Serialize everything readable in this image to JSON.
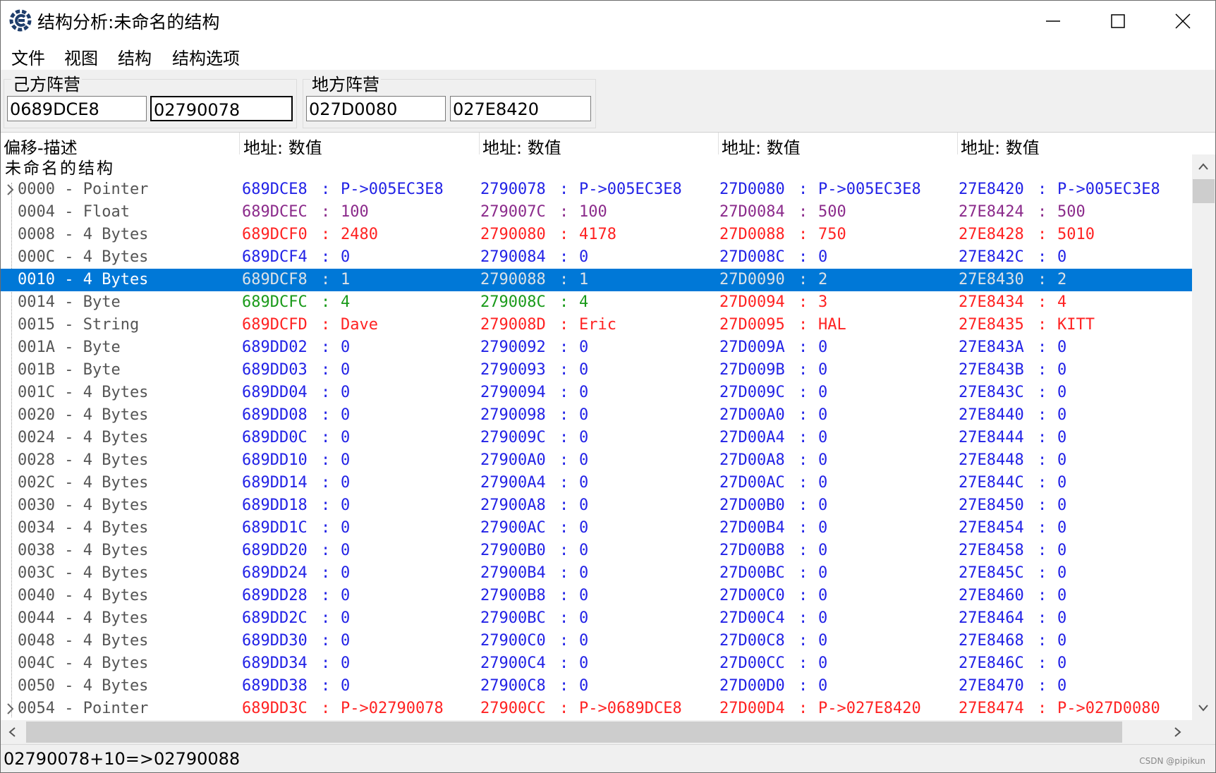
{
  "window": {
    "title": "结构分析:未命名的结构"
  },
  "menu": [
    "文件",
    "视图",
    "结构",
    "结构选项"
  ],
  "groups": [
    {
      "label": "己方阵营",
      "addresses": [
        "0689DCE8",
        "02790078"
      ]
    },
    {
      "label": "地方阵营",
      "addresses": [
        "027D0080",
        "027E8420"
      ]
    }
  ],
  "columns": [
    "偏移-描述",
    "地址: 数值",
    "地址: 数值",
    "地址: 数值",
    "地址: 数值"
  ],
  "struct_name": "未命名的结构",
  "colors": {
    "blue": "#2222e6",
    "red": "#ff2222",
    "purple": "#8b2b8b",
    "green": "#1a9a1a",
    "selection": "#0078d7"
  },
  "rows": [
    {
      "offset": "0000 - Pointer",
      "expandable": true,
      "cells": [
        {
          "addr": "689DCE8",
          "val": "P->005EC3E8",
          "color": "blue"
        },
        {
          "addr": "2790078",
          "val": "P->005EC3E8",
          "color": "blue"
        },
        {
          "addr": "27D0080",
          "val": "P->005EC3E8",
          "color": "blue"
        },
        {
          "addr": "27E8420",
          "val": "P->005EC3E8",
          "color": "blue"
        }
      ]
    },
    {
      "offset": "0004 - Float",
      "cells": [
        {
          "addr": "689DCEC",
          "val": "100",
          "color": "purple"
        },
        {
          "addr": "279007C",
          "val": "100",
          "color": "purple"
        },
        {
          "addr": "27D0084",
          "val": "500",
          "color": "purple"
        },
        {
          "addr": "27E8424",
          "val": "500",
          "color": "purple"
        }
      ]
    },
    {
      "offset": "0008 - 4 Bytes",
      "cells": [
        {
          "addr": "689DCF0",
          "val": "2480",
          "color": "red"
        },
        {
          "addr": "2790080",
          "val": "4178",
          "color": "red"
        },
        {
          "addr": "27D0088",
          "val": "750",
          "color": "red"
        },
        {
          "addr": "27E8428",
          "val": "5010",
          "color": "red"
        }
      ]
    },
    {
      "offset": "000C - 4 Bytes",
      "cells": [
        {
          "addr": "689DCF4",
          "val": "0",
          "color": "blue"
        },
        {
          "addr": "2790084",
          "val": "0",
          "color": "blue"
        },
        {
          "addr": "27D008C",
          "val": "0",
          "color": "blue"
        },
        {
          "addr": "27E842C",
          "val": "0",
          "color": "blue"
        }
      ]
    },
    {
      "offset": "0010 - 4 Bytes",
      "selected": true,
      "cells": [
        {
          "addr": "689DCF8",
          "val": "1",
          "color": "blue"
        },
        {
          "addr": "2790088",
          "val": "1",
          "color": "blue"
        },
        {
          "addr": "27D0090",
          "val": "2",
          "color": "red"
        },
        {
          "addr": "27E8430",
          "val": "2",
          "color": "red"
        }
      ]
    },
    {
      "offset": "0014 - Byte",
      "cells": [
        {
          "addr": "689DCFC",
          "val": "4",
          "color": "green"
        },
        {
          "addr": "279008C",
          "val": "4",
          "color": "green"
        },
        {
          "addr": "27D0094",
          "val": "3",
          "color": "red"
        },
        {
          "addr": "27E8434",
          "val": "4",
          "color": "red"
        }
      ]
    },
    {
      "offset": "0015 - String",
      "cells": [
        {
          "addr": "689DCFD",
          "val": "Dave",
          "color": "red"
        },
        {
          "addr": "279008D",
          "val": "Eric",
          "color": "red"
        },
        {
          "addr": "27D0095",
          "val": "HAL",
          "color": "red"
        },
        {
          "addr": "27E8435",
          "val": "KITT",
          "color": "red"
        }
      ]
    },
    {
      "offset": "001A - Byte",
      "cells": [
        {
          "addr": "689DD02",
          "val": "0",
          "color": "blue"
        },
        {
          "addr": "2790092",
          "val": "0",
          "color": "blue"
        },
        {
          "addr": "27D009A",
          "val": "0",
          "color": "blue"
        },
        {
          "addr": "27E843A",
          "val": "0",
          "color": "blue"
        }
      ]
    },
    {
      "offset": "001B - Byte",
      "cells": [
        {
          "addr": "689DD03",
          "val": "0",
          "color": "blue"
        },
        {
          "addr": "2790093",
          "val": "0",
          "color": "blue"
        },
        {
          "addr": "27D009B",
          "val": "0",
          "color": "blue"
        },
        {
          "addr": "27E843B",
          "val": "0",
          "color": "blue"
        }
      ]
    },
    {
      "offset": "001C - 4 Bytes",
      "cells": [
        {
          "addr": "689DD04",
          "val": "0",
          "color": "blue"
        },
        {
          "addr": "2790094",
          "val": "0",
          "color": "blue"
        },
        {
          "addr": "27D009C",
          "val": "0",
          "color": "blue"
        },
        {
          "addr": "27E843C",
          "val": "0",
          "color": "blue"
        }
      ]
    },
    {
      "offset": "0020 - 4 Bytes",
      "cells": [
        {
          "addr": "689DD08",
          "val": "0",
          "color": "blue"
        },
        {
          "addr": "2790098",
          "val": "0",
          "color": "blue"
        },
        {
          "addr": "27D00A0",
          "val": "0",
          "color": "blue"
        },
        {
          "addr": "27E8440",
          "val": "0",
          "color": "blue"
        }
      ]
    },
    {
      "offset": "0024 - 4 Bytes",
      "cells": [
        {
          "addr": "689DD0C",
          "val": "0",
          "color": "blue"
        },
        {
          "addr": "279009C",
          "val": "0",
          "color": "blue"
        },
        {
          "addr": "27D00A4",
          "val": "0",
          "color": "blue"
        },
        {
          "addr": "27E8444",
          "val": "0",
          "color": "blue"
        }
      ]
    },
    {
      "offset": "0028 - 4 Bytes",
      "cells": [
        {
          "addr": "689DD10",
          "val": "0",
          "color": "blue"
        },
        {
          "addr": "27900A0",
          "val": "0",
          "color": "blue"
        },
        {
          "addr": "27D00A8",
          "val": "0",
          "color": "blue"
        },
        {
          "addr": "27E8448",
          "val": "0",
          "color": "blue"
        }
      ]
    },
    {
      "offset": "002C - 4 Bytes",
      "cells": [
        {
          "addr": "689DD14",
          "val": "0",
          "color": "blue"
        },
        {
          "addr": "27900A4",
          "val": "0",
          "color": "blue"
        },
        {
          "addr": "27D00AC",
          "val": "0",
          "color": "blue"
        },
        {
          "addr": "27E844C",
          "val": "0",
          "color": "blue"
        }
      ]
    },
    {
      "offset": "0030 - 4 Bytes",
      "cells": [
        {
          "addr": "689DD18",
          "val": "0",
          "color": "blue"
        },
        {
          "addr": "27900A8",
          "val": "0",
          "color": "blue"
        },
        {
          "addr": "27D00B0",
          "val": "0",
          "color": "blue"
        },
        {
          "addr": "27E8450",
          "val": "0",
          "color": "blue"
        }
      ]
    },
    {
      "offset": "0034 - 4 Bytes",
      "cells": [
        {
          "addr": "689DD1C",
          "val": "0",
          "color": "blue"
        },
        {
          "addr": "27900AC",
          "val": "0",
          "color": "blue"
        },
        {
          "addr": "27D00B4",
          "val": "0",
          "color": "blue"
        },
        {
          "addr": "27E8454",
          "val": "0",
          "color": "blue"
        }
      ]
    },
    {
      "offset": "0038 - 4 Bytes",
      "cells": [
        {
          "addr": "689DD20",
          "val": "0",
          "color": "blue"
        },
        {
          "addr": "27900B0",
          "val": "0",
          "color": "blue"
        },
        {
          "addr": "27D00B8",
          "val": "0",
          "color": "blue"
        },
        {
          "addr": "27E8458",
          "val": "0",
          "color": "blue"
        }
      ]
    },
    {
      "offset": "003C - 4 Bytes",
      "cells": [
        {
          "addr": "689DD24",
          "val": "0",
          "color": "blue"
        },
        {
          "addr": "27900B4",
          "val": "0",
          "color": "blue"
        },
        {
          "addr": "27D00BC",
          "val": "0",
          "color": "blue"
        },
        {
          "addr": "27E845C",
          "val": "0",
          "color": "blue"
        }
      ]
    },
    {
      "offset": "0040 - 4 Bytes",
      "cells": [
        {
          "addr": "689DD28",
          "val": "0",
          "color": "blue"
        },
        {
          "addr": "27900B8",
          "val": "0",
          "color": "blue"
        },
        {
          "addr": "27D00C0",
          "val": "0",
          "color": "blue"
        },
        {
          "addr": "27E8460",
          "val": "0",
          "color": "blue"
        }
      ]
    },
    {
      "offset": "0044 - 4 Bytes",
      "cells": [
        {
          "addr": "689DD2C",
          "val": "0",
          "color": "blue"
        },
        {
          "addr": "27900BC",
          "val": "0",
          "color": "blue"
        },
        {
          "addr": "27D00C4",
          "val": "0",
          "color": "blue"
        },
        {
          "addr": "27E8464",
          "val": "0",
          "color": "blue"
        }
      ]
    },
    {
      "offset": "0048 - 4 Bytes",
      "cells": [
        {
          "addr": "689DD30",
          "val": "0",
          "color": "blue"
        },
        {
          "addr": "27900C0",
          "val": "0",
          "color": "blue"
        },
        {
          "addr": "27D00C8",
          "val": "0",
          "color": "blue"
        },
        {
          "addr": "27E8468",
          "val": "0",
          "color": "blue"
        }
      ]
    },
    {
      "offset": "004C - 4 Bytes",
      "cells": [
        {
          "addr": "689DD34",
          "val": "0",
          "color": "blue"
        },
        {
          "addr": "27900C4",
          "val": "0",
          "color": "blue"
        },
        {
          "addr": "27D00CC",
          "val": "0",
          "color": "blue"
        },
        {
          "addr": "27E846C",
          "val": "0",
          "color": "blue"
        }
      ]
    },
    {
      "offset": "0050 - 4 Bytes",
      "cells": [
        {
          "addr": "689DD38",
          "val": "0",
          "color": "blue"
        },
        {
          "addr": "27900C8",
          "val": "0",
          "color": "blue"
        },
        {
          "addr": "27D00D0",
          "val": "0",
          "color": "blue"
        },
        {
          "addr": "27E8470",
          "val": "0",
          "color": "blue"
        }
      ]
    },
    {
      "offset": "0054 - Pointer",
      "expandable": true,
      "cells": [
        {
          "addr": "689DD3C",
          "val": "P->02790078",
          "color": "red"
        },
        {
          "addr": "27900CC",
          "val": "P->0689DCE8",
          "color": "red"
        },
        {
          "addr": "27D00D4",
          "val": "P->027E8420",
          "color": "red"
        },
        {
          "addr": "27E8474",
          "val": "P->027D0080",
          "color": "red"
        }
      ]
    }
  ],
  "status": "02790078+10=>02790088",
  "watermark": "CSDN @pipikun"
}
